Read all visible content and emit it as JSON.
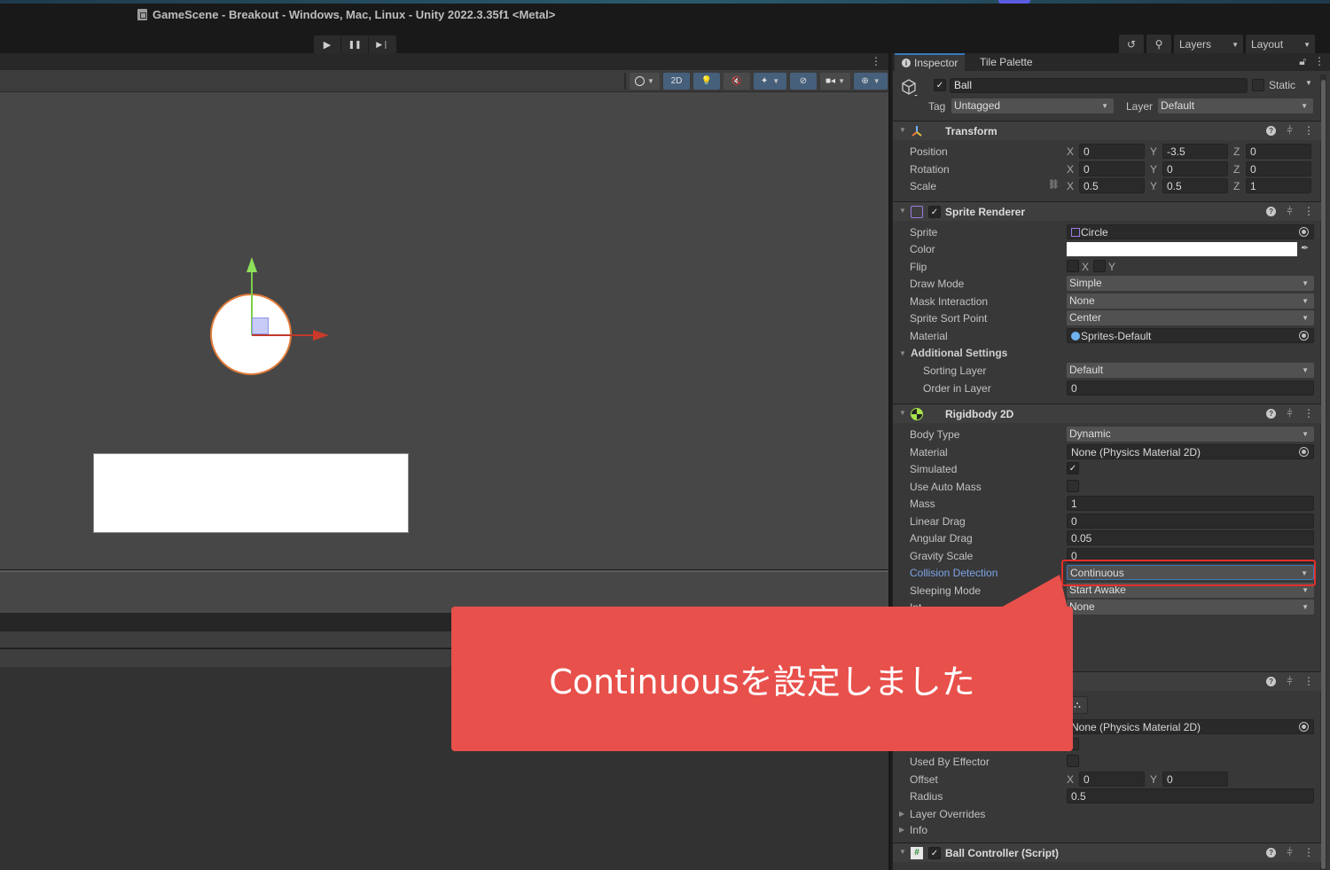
{
  "window": {
    "title": "GameScene - Breakout - Windows, Mac, Linux - Unity 2022.3.35f1 <Metal>"
  },
  "toolbar": {
    "play": "▶",
    "pause": "❚❚",
    "step": "▶❘",
    "history_icon": "↺",
    "search_icon": "⚲",
    "layers_label": "Layers",
    "layout_label": "Layout"
  },
  "scene_toolbar": {
    "mode_2d": "2D",
    "kebab": "⋮"
  },
  "inspector": {
    "tabs": [
      {
        "label": "Inspector",
        "active": true
      },
      {
        "label": "Tile Palette",
        "active": false
      }
    ],
    "game_object": {
      "active": true,
      "name": "Ball",
      "static_label": "Static",
      "static": false,
      "tag_label": "Tag",
      "tag": "Untagged",
      "layer_label": "Layer",
      "layer": "Default"
    },
    "transform": {
      "title": "Transform",
      "rows": [
        {
          "label": "Position",
          "x": "0",
          "y": "-3.5",
          "z": "0"
        },
        {
          "label": "Rotation",
          "x": "0",
          "y": "0",
          "z": "0"
        },
        {
          "label": "Scale",
          "x": "0.5",
          "y": "0.5",
          "z": "1"
        }
      ]
    },
    "sprite_renderer": {
      "title": "Sprite Renderer",
      "enabled": true,
      "sprite_label": "Sprite",
      "sprite": "Circle",
      "color_label": "Color",
      "color": "#ffffff",
      "flip_label": "Flip",
      "flip_x": "X",
      "flip_y": "Y",
      "draw_mode_label": "Draw Mode",
      "draw_mode": "Simple",
      "mask_label": "Mask Interaction",
      "mask": "None",
      "sort_point_label": "Sprite Sort Point",
      "sort_point": "Center",
      "material_label": "Material",
      "material": "Sprites-Default",
      "additional_label": "Additional Settings",
      "sorting_layer_label": "Sorting Layer",
      "sorting_layer": "Default",
      "order_label": "Order in Layer",
      "order": "0"
    },
    "rigidbody": {
      "title": "Rigidbody 2D",
      "body_type_label": "Body Type",
      "body_type": "Dynamic",
      "material_label": "Material",
      "material": "None (Physics Material 2D)",
      "simulated_label": "Simulated",
      "simulated": true,
      "auto_mass_label": "Use Auto Mass",
      "auto_mass": false,
      "mass_label": "Mass",
      "mass": "1",
      "linear_drag_label": "Linear Drag",
      "linear_drag": "0",
      "angular_drag_label": "Angular Drag",
      "angular_drag": "0.05",
      "gravity_label": "Gravity Scale",
      "gravity": "0",
      "collision_label": "Collision Detection",
      "collision": "Continuous",
      "sleeping_label": "Sleeping Mode",
      "sleeping": "Start Awake",
      "interp_label": "Int",
      "interp": "None"
    },
    "collider": {
      "material": "None (Physics Material 2D)",
      "used_by_effector_label": "Used By Effector",
      "offset_label": "Offset",
      "offset_x": "0",
      "offset_y": "0",
      "radius_label": "Radius",
      "radius": "0.5",
      "layer_overrides_label": "Layer Overrides",
      "info_label": "Info"
    },
    "ball_controller": {
      "title": "Ball Controller (Script)",
      "enabled": true
    }
  },
  "callout": {
    "text": "Continuousを設定しました",
    "color": "#e8504b"
  },
  "highlight_color": "#e0302b"
}
